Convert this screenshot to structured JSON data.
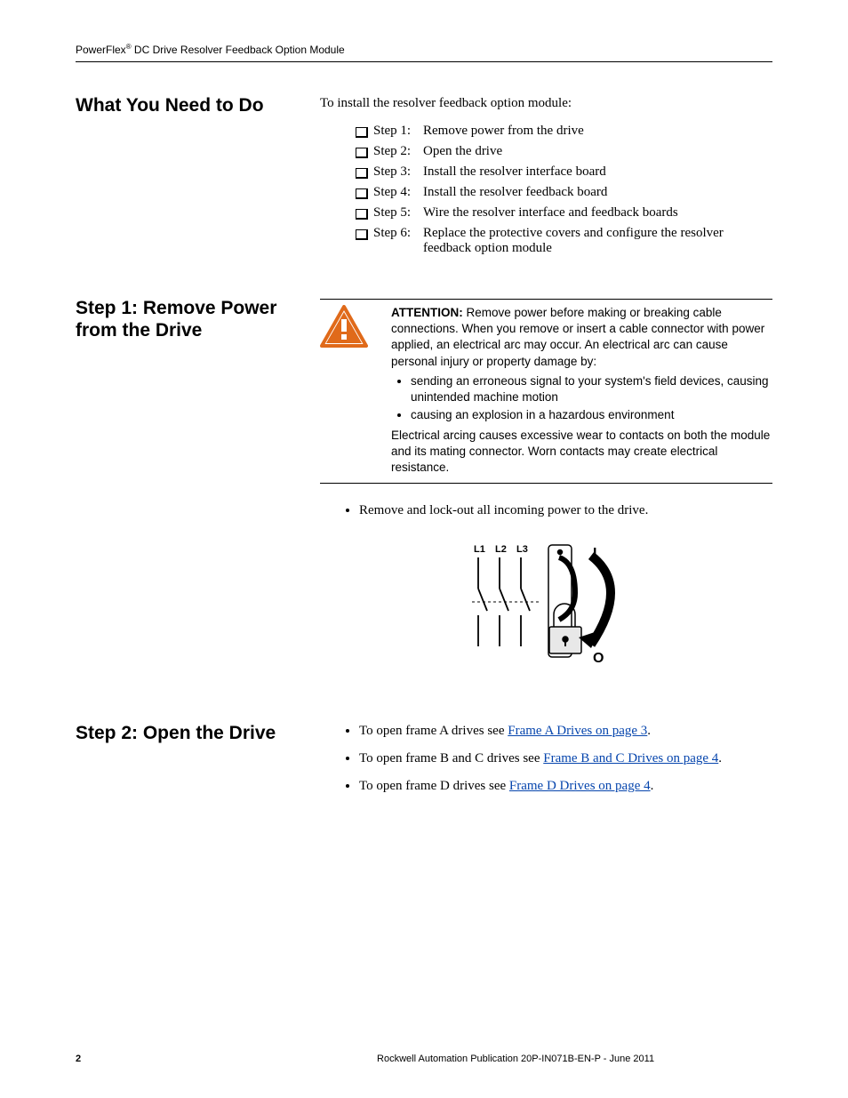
{
  "header": {
    "product_prefix": "PowerFlex",
    "product_suffix": " DC Drive Resolver Feedback Option Module",
    "reg_mark": "®"
  },
  "section1": {
    "heading": "What You Need to Do",
    "intro": "To install the resolver feedback option module:",
    "steps": [
      {
        "label": "Step 1:",
        "text": "Remove power from the drive"
      },
      {
        "label": "Step 2:",
        "text": "Open the drive"
      },
      {
        "label": "Step 3:",
        "text": "Install the resolver interface board"
      },
      {
        "label": "Step 4:",
        "text": "Install the resolver feedback board"
      },
      {
        "label": "Step 5:",
        "text": "Wire the resolver interface and feedback boards"
      },
      {
        "label": "Step 6:",
        "text": "Replace the protective covers and configure the resolver feedback option module"
      }
    ]
  },
  "section2": {
    "heading": "Step 1:  Remove Power from the Drive",
    "attention": {
      "label": "ATTENTION:",
      "lead": " Remove power before making or breaking cable connections. When you remove or insert a cable connector with power applied, an electrical arc may occur. An electrical arc can cause personal injury or property damage by:",
      "bullets": [
        "sending an erroneous signal to your system's field devices, causing unintended machine motion",
        "causing an explosion in a hazardous environment"
      ],
      "trail": "Electrical arcing causes excessive wear to contacts on both the module and its mating connector. Worn contacts may create electrical resistance."
    },
    "action_bullet": "Remove and lock-out all incoming power to the drive.",
    "figure_labels": {
      "l1": "L1",
      "l2": "L2",
      "l3": "L3",
      "i": "I",
      "o": "O"
    }
  },
  "section3": {
    "heading": "Step 2:  Open the Drive",
    "bullets": [
      {
        "pre": "To open frame A drives see ",
        "link": "Frame A Drives on page 3",
        "post": "."
      },
      {
        "pre": "To open frame B and C drives see ",
        "link": "Frame B and C Drives on page 4",
        "post": "."
      },
      {
        "pre": "To open frame D drives see ",
        "link": "Frame D Drives on page 4",
        "post": "."
      }
    ]
  },
  "footer": {
    "page_number": "2",
    "publication": "Rockwell Automation Publication 20P-IN071B-EN-P - June 2011"
  }
}
